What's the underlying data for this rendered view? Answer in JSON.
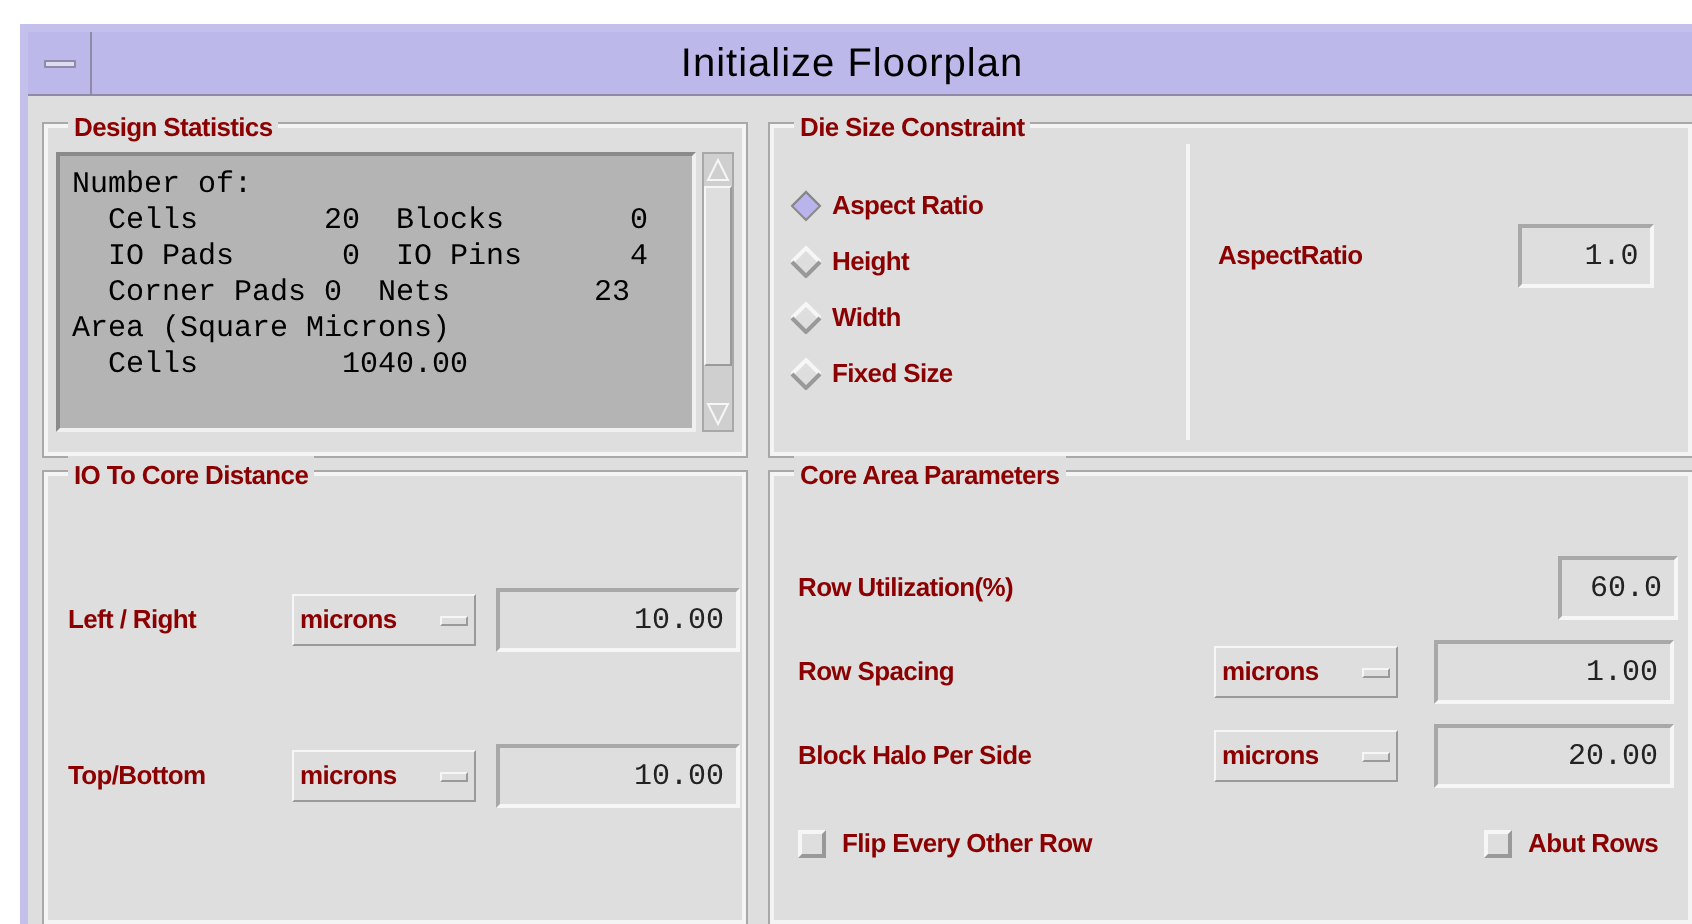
{
  "window": {
    "title": "Initialize Floorplan"
  },
  "design_statistics": {
    "title": "Design Statistics",
    "lines": [
      "Number of:",
      "  Cells       20  Blocks       0",
      "  IO Pads      0  IO Pins      4",
      "  Corner Pads 0  Nets        23",
      "Area (Square Microns)",
      "  Cells        1040.00"
    ]
  },
  "die_size_constraint": {
    "title": "Die Size Constraint",
    "options": [
      {
        "label": "Aspect Ratio",
        "selected": true
      },
      {
        "label": "Height",
        "selected": false
      },
      {
        "label": "Width",
        "selected": false
      },
      {
        "label": "Fixed Size",
        "selected": false
      }
    ],
    "field": {
      "label": "AspectRatio",
      "value": "1.0"
    }
  },
  "io_to_core_distance": {
    "title": "IO To Core Distance",
    "rows": [
      {
        "label": "Left / Right",
        "unit": "microns",
        "value": "10.00"
      },
      {
        "label": "Top/Bottom",
        "unit": "microns",
        "value": "10.00"
      }
    ]
  },
  "core_area_parameters": {
    "title": "Core Area Parameters",
    "rows": [
      {
        "kind": "plain",
        "label": "Row Utilization(%)",
        "value": "60.0"
      },
      {
        "kind": "unit",
        "label": "Row Spacing",
        "unit": "microns",
        "value": "1.00"
      },
      {
        "kind": "unit",
        "label": "Block Halo Per Side",
        "unit": "microns",
        "value": "20.00"
      }
    ],
    "checkboxes": [
      {
        "label": "Flip Every Other Row",
        "checked": false
      },
      {
        "label": "Abut Rows",
        "checked": false
      }
    ]
  }
}
